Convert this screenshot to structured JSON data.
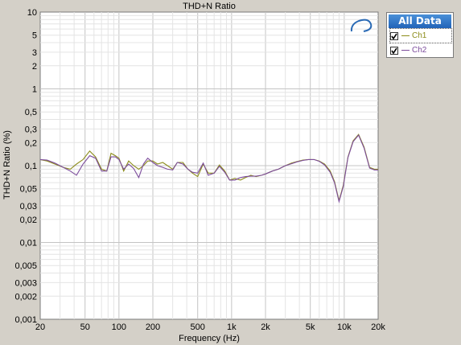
{
  "chart_data": {
    "type": "line",
    "title": "THD+N Ratio",
    "xlabel": "Frequency (Hz)",
    "ylabel": "THD+N Ratio (%)",
    "xscale": "log",
    "yscale": "log",
    "xlim": [
      20,
      20000
    ],
    "ylim": [
      0.001,
      10
    ],
    "grid": true,
    "legend_position": "top-right",
    "x_ticks": [
      {
        "v": 20,
        "label": "20"
      },
      {
        "v": 50,
        "label": "50"
      },
      {
        "v": 100,
        "label": "100"
      },
      {
        "v": 200,
        "label": "200"
      },
      {
        "v": 500,
        "label": "500"
      },
      {
        "v": 1000,
        "label": "1k"
      },
      {
        "v": 2000,
        "label": "2k"
      },
      {
        "v": 5000,
        "label": "5k"
      },
      {
        "v": 10000,
        "label": "10k"
      },
      {
        "v": 20000,
        "label": "20k"
      }
    ],
    "y_ticks": [
      {
        "v": 10,
        "label": "10"
      },
      {
        "v": 5,
        "label": "5"
      },
      {
        "v": 3,
        "label": "3"
      },
      {
        "v": 2,
        "label": "2"
      },
      {
        "v": 1,
        "label": "1"
      },
      {
        "v": 0.5,
        "label": "0,5"
      },
      {
        "v": 0.3,
        "label": "0,3"
      },
      {
        "v": 0.2,
        "label": "0,2"
      },
      {
        "v": 0.1,
        "label": "0,1"
      },
      {
        "v": 0.05,
        "label": "0,05"
      },
      {
        "v": 0.03,
        "label": "0,03"
      },
      {
        "v": 0.02,
        "label": "0,02"
      },
      {
        "v": 0.01,
        "label": "0,01"
      },
      {
        "v": 0.005,
        "label": "0,005"
      },
      {
        "v": 0.003,
        "label": "0,003"
      },
      {
        "v": 0.002,
        "label": "0,002"
      },
      {
        "v": 0.001,
        "label": "0,001"
      }
    ],
    "series": [
      {
        "name": "Ch1",
        "color": "#8c8c1a",
        "points": [
          [
            20,
            0.12
          ],
          [
            23,
            0.115
          ],
          [
            27,
            0.105
          ],
          [
            32,
            0.095
          ],
          [
            37,
            0.09
          ],
          [
            42,
            0.105
          ],
          [
            48,
            0.12
          ],
          [
            55,
            0.155
          ],
          [
            62,
            0.13
          ],
          [
            70,
            0.09
          ],
          [
            78,
            0.085
          ],
          [
            85,
            0.145
          ],
          [
            93,
            0.135
          ],
          [
            100,
            0.125
          ],
          [
            110,
            0.085
          ],
          [
            122,
            0.115
          ],
          [
            135,
            0.1
          ],
          [
            150,
            0.09
          ],
          [
            165,
            0.1
          ],
          [
            180,
            0.115
          ],
          [
            200,
            0.115
          ],
          [
            220,
            0.105
          ],
          [
            245,
            0.11
          ],
          [
            270,
            0.1
          ],
          [
            300,
            0.09
          ],
          [
            330,
            0.11
          ],
          [
            370,
            0.11
          ],
          [
            410,
            0.09
          ],
          [
            450,
            0.08
          ],
          [
            500,
            0.072
          ],
          [
            560,
            0.105
          ],
          [
            620,
            0.08
          ],
          [
            700,
            0.08
          ],
          [
            780,
            0.102
          ],
          [
            870,
            0.085
          ],
          [
            960,
            0.065
          ],
          [
            1070,
            0.068
          ],
          [
            1200,
            0.065
          ],
          [
            1330,
            0.07
          ],
          [
            1480,
            0.075
          ],
          [
            1650,
            0.072
          ],
          [
            1850,
            0.075
          ],
          [
            2000,
            0.078
          ],
          [
            2300,
            0.085
          ],
          [
            2600,
            0.09
          ],
          [
            3000,
            0.1
          ],
          [
            3400,
            0.108
          ],
          [
            3800,
            0.113
          ],
          [
            4300,
            0.118
          ],
          [
            4800,
            0.12
          ],
          [
            5400,
            0.12
          ],
          [
            6000,
            0.115
          ],
          [
            6700,
            0.105
          ],
          [
            7500,
            0.085
          ],
          [
            8200,
            0.062
          ],
          [
            9000,
            0.035
          ],
          [
            9800,
            0.055
          ],
          [
            10800,
            0.13
          ],
          [
            12000,
            0.21
          ],
          [
            13400,
            0.255
          ],
          [
            15000,
            0.175
          ],
          [
            16800,
            0.095
          ],
          [
            18500,
            0.09
          ],
          [
            20000,
            0.09
          ]
        ]
      },
      {
        "name": "Ch2",
        "color": "#7c4c9c",
        "points": [
          [
            20,
            0.12
          ],
          [
            23,
            0.118
          ],
          [
            27,
            0.108
          ],
          [
            32,
            0.095
          ],
          [
            37,
            0.085
          ],
          [
            42,
            0.075
          ],
          [
            48,
            0.105
          ],
          [
            55,
            0.135
          ],
          [
            62,
            0.125
          ],
          [
            70,
            0.085
          ],
          [
            78,
            0.085
          ],
          [
            85,
            0.13
          ],
          [
            93,
            0.13
          ],
          [
            100,
            0.12
          ],
          [
            110,
            0.09
          ],
          [
            122,
            0.105
          ],
          [
            135,
            0.092
          ],
          [
            150,
            0.07
          ],
          [
            165,
            0.105
          ],
          [
            180,
            0.125
          ],
          [
            200,
            0.11
          ],
          [
            220,
            0.1
          ],
          [
            245,
            0.095
          ],
          [
            270,
            0.09
          ],
          [
            300,
            0.088
          ],
          [
            330,
            0.11
          ],
          [
            370,
            0.105
          ],
          [
            410,
            0.09
          ],
          [
            450,
            0.082
          ],
          [
            500,
            0.08
          ],
          [
            560,
            0.108
          ],
          [
            620,
            0.075
          ],
          [
            700,
            0.08
          ],
          [
            780,
            0.098
          ],
          [
            870,
            0.082
          ],
          [
            960,
            0.065
          ],
          [
            1070,
            0.065
          ],
          [
            1200,
            0.07
          ],
          [
            1330,
            0.072
          ],
          [
            1480,
            0.073
          ],
          [
            1650,
            0.073
          ],
          [
            1850,
            0.075
          ],
          [
            2000,
            0.078
          ],
          [
            2300,
            0.085
          ],
          [
            2600,
            0.09
          ],
          [
            3000,
            0.1
          ],
          [
            3400,
            0.106
          ],
          [
            3800,
            0.112
          ],
          [
            4300,
            0.117
          ],
          [
            4800,
            0.12
          ],
          [
            5400,
            0.12
          ],
          [
            6000,
            0.114
          ],
          [
            6700,
            0.102
          ],
          [
            7500,
            0.082
          ],
          [
            8200,
            0.06
          ],
          [
            9000,
            0.034
          ],
          [
            9800,
            0.053
          ],
          [
            10800,
            0.128
          ],
          [
            12000,
            0.205
          ],
          [
            13400,
            0.25
          ],
          [
            15000,
            0.17
          ],
          [
            16800,
            0.093
          ],
          [
            18500,
            0.088
          ],
          [
            20000,
            0.088
          ]
        ]
      }
    ]
  },
  "legend": {
    "header": "All Data",
    "items": [
      {
        "label": "Ch1",
        "checked": true
      },
      {
        "label": "Ch2",
        "checked": true
      }
    ]
  },
  "logo_text": "AP"
}
